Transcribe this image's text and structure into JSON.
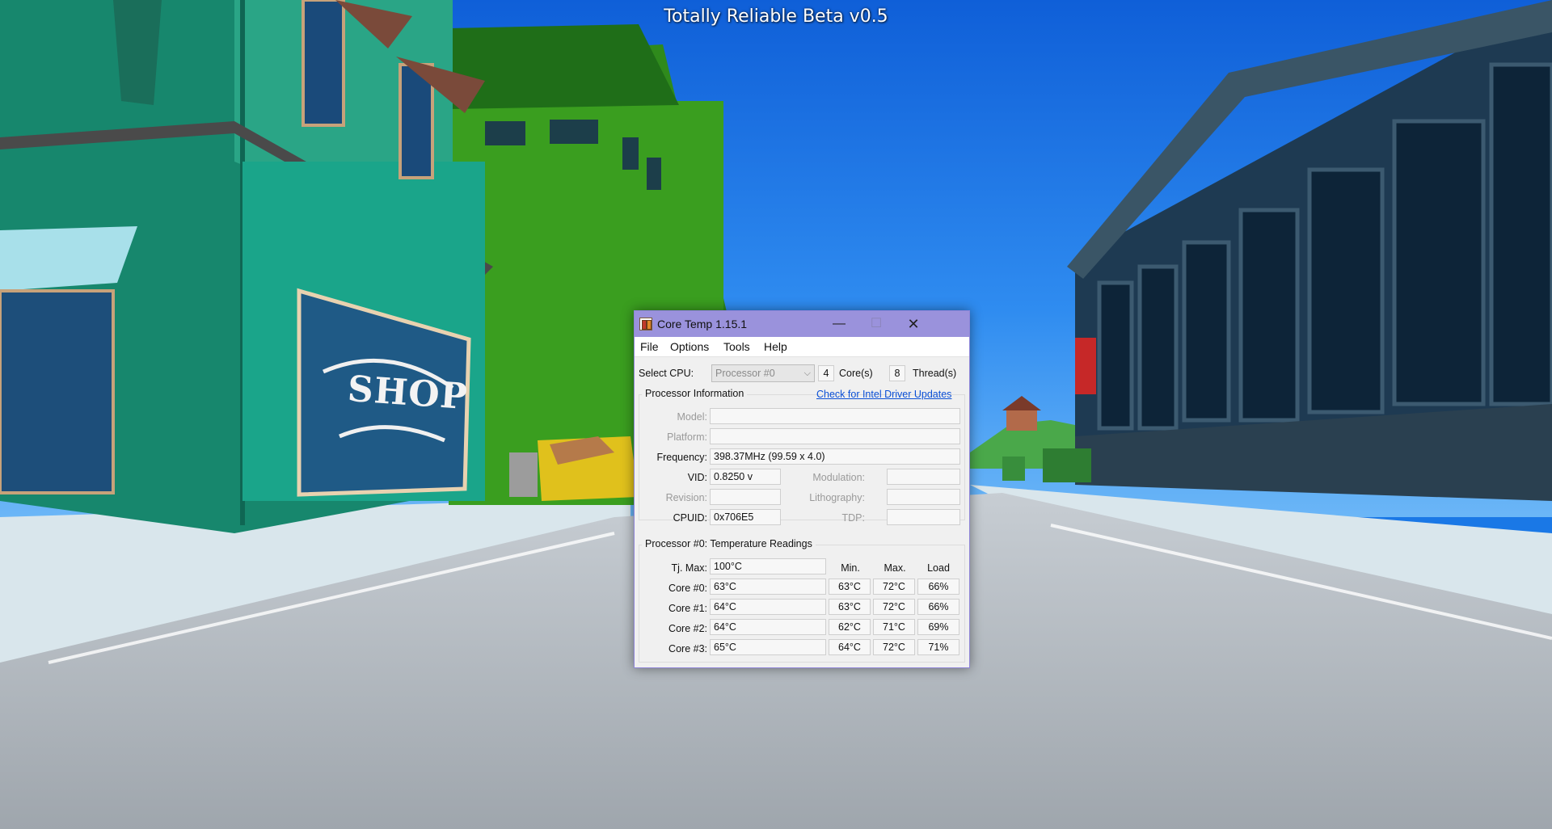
{
  "game": {
    "title": "Totally Reliable Beta v0.5",
    "shop_sign": "SHOP"
  },
  "window": {
    "title": "Core Temp 1.15.1",
    "minimize": "—",
    "maximize": "☐",
    "close": "✕"
  },
  "menu": {
    "file": "File",
    "options": "Options",
    "tools": "Tools",
    "help": "Help"
  },
  "cpu_select": {
    "label": "Select CPU:",
    "value": "Processor #0",
    "cores_value": "4",
    "cores_label": "Core(s)",
    "threads_value": "8",
    "threads_label": "Thread(s)"
  },
  "proc_info": {
    "group_label": "Processor Information",
    "link": "Check for Intel Driver Updates",
    "model_label": "Model:",
    "model_value": "",
    "platform_label": "Platform:",
    "platform_value": "",
    "frequency_label": "Frequency:",
    "frequency_value": "398.37MHz (99.59 x 4.0)",
    "vid_label": "VID:",
    "vid_value": "0.8250 v",
    "revision_label": "Revision:",
    "revision_value": "",
    "cpuid_label": "CPUID:",
    "cpuid_value": "0x706E5",
    "modulation_label": "Modulation:",
    "modulation_value": "",
    "lithography_label": "Lithography:",
    "lithography_value": "",
    "tdp_label": "TDP:",
    "tdp_value": ""
  },
  "temps": {
    "group_label": "Processor #0: Temperature Readings",
    "tjmax_label": "Tj. Max:",
    "tjmax_value": "100°C",
    "col_min": "Min.",
    "col_max": "Max.",
    "col_load": "Load",
    "cores": [
      {
        "label": "Core #0:",
        "temp": "63°C",
        "min": "63°C",
        "max": "72°C",
        "load": "66%"
      },
      {
        "label": "Core #1:",
        "temp": "64°C",
        "min": "63°C",
        "max": "72°C",
        "load": "66%"
      },
      {
        "label": "Core #2:",
        "temp": "64°C",
        "min": "62°C",
        "max": "71°C",
        "load": "69%"
      },
      {
        "label": "Core #3:",
        "temp": "65°C",
        "min": "64°C",
        "max": "72°C",
        "load": "71%"
      }
    ]
  },
  "colors": {
    "sky": "#1a78e6",
    "titlebar": "#9a92dc",
    "link": "#0a4fd6"
  }
}
